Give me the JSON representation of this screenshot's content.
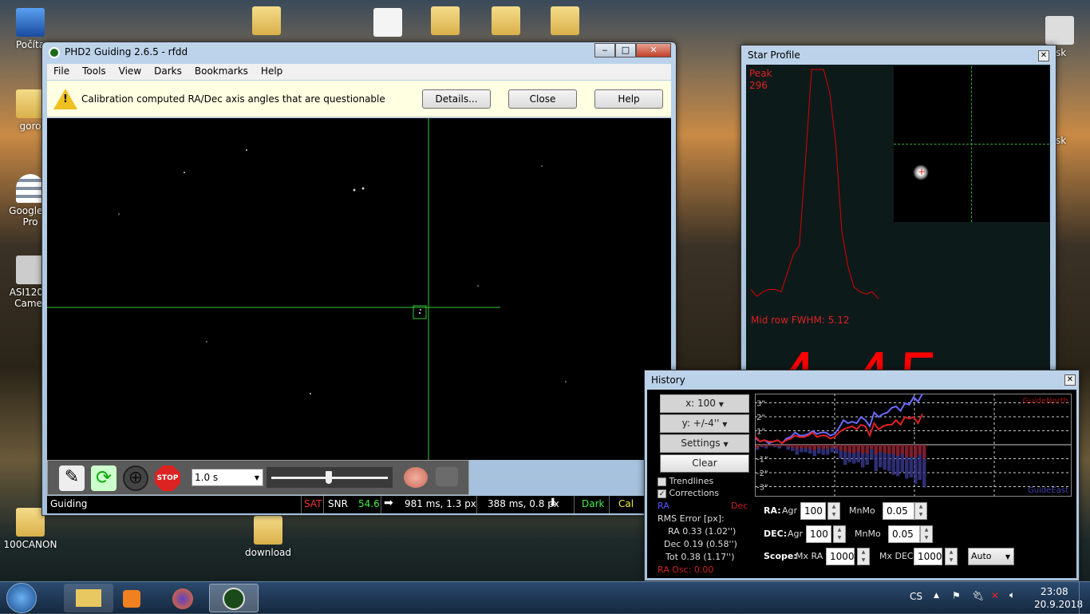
{
  "desktop": {
    "icons": [
      {
        "label": "Počíta"
      },
      {
        "label": "goro"
      },
      {
        "label": "Google E Pro"
      },
      {
        "label": "ASI120M Camer"
      },
      {
        "label": "100CANON"
      },
      {
        "label": "download"
      },
      {
        "label": "isk"
      },
      {
        "label": "isk"
      }
    ]
  },
  "phd2": {
    "title": "PHD2 Guiding 2.6.5 - rfdd",
    "menu": [
      "File",
      "Tools",
      "View",
      "Darks",
      "Bookmarks",
      "Help"
    ],
    "info": {
      "message": "Calibration computed RA/Dec axis angles that are questionable",
      "details": "Details...",
      "close": "Close",
      "help": "Help"
    },
    "toolbar": {
      "exposure": "1.0 s",
      "gamma_fraction": 0.49
    },
    "status": {
      "state": "Guiding",
      "sat": "SAT",
      "snr_label": "SNR",
      "snr": "54.6",
      "ra_pulse": "981 ms, 1.3 px",
      "dec_pulse": "388 ms, 0.8 px",
      "dark": "Dark",
      "cal": "Cal"
    }
  },
  "star_profile": {
    "title": "Star Profile",
    "peak_label": "Peak",
    "peak": "296",
    "fwhm": "Mid row FWHM: 5.12",
    "hfd": "4.45",
    "profile": [
      5,
      2,
      4,
      5,
      5,
      4,
      12,
      20,
      24,
      60,
      100,
      100,
      100,
      90,
      68,
      30,
      15,
      6,
      4,
      3,
      4,
      1
    ]
  },
  "history": {
    "title": "History",
    "x_scale": "x: 100",
    "y_scale": "y: +/-4''",
    "settings": "Settings",
    "clear": "Clear",
    "trendlines": "Trendlines",
    "trendlines_checked": false,
    "corrections": "Corrections",
    "corrections_checked": true,
    "ra_label": "RA",
    "dec_label": "Dec",
    "rms_title": "RMS Error [px]:",
    "rms_ra": "RA 0.33 (1.02'')",
    "rms_dec": "Dec 0.19 (0.58'')",
    "rms_tot": "Tot 0.38 (1.17'')",
    "ra_osc": "RA Osc: 0.00",
    "y_ticks": [
      "3\"",
      "2\"",
      "1\"",
      "-1\"",
      "-2\"",
      "-3\""
    ],
    "north": "GuideNorth",
    "east": "GuideEast",
    "ra_color": "#6a6aff",
    "dec_color": "#e02020",
    "ra_values": [
      0.4,
      0.2,
      0.3,
      0.1,
      0.2,
      0.3,
      0.1,
      0.4,
      0.5,
      0.8,
      0.6,
      0.6,
      0.7,
      0.9,
      0.7,
      0.8,
      0.8,
      0.6,
      0.7,
      1.1,
      1.6,
      1.4,
      1.5,
      1.4,
      1.8,
      1.6,
      1.2,
      2.1,
      1.8,
      2.0,
      2.1,
      2.4,
      2.5,
      2.2,
      2.7,
      2.6,
      3.1,
      2.8,
      3.4
    ],
    "dec_values": [
      0.5,
      0.2,
      0.3,
      0.2,
      0.2,
      0.3,
      0.1,
      0.3,
      0.4,
      0.6,
      0.5,
      0.5,
      0.6,
      0.8,
      0.5,
      0.6,
      0.6,
      0.4,
      0.5,
      0.8,
      1.0,
      1.1,
      1.2,
      1.0,
      1.3,
      1.2,
      0.6,
      1.4,
      1.0,
      1.2,
      1.3,
      1.3,
      1.6,
      1.3,
      1.8,
      1.7,
      1.8,
      1.4,
      2.0
    ],
    "ra_label_b": "RA:",
    "agr": "Agr",
    "ra_agr": "100",
    "mnmo": "MnMo",
    "ra_mnmo": "0.05",
    "dec_label_b": "DEC:",
    "dec_agr": "100",
    "dec_mnmo": "0.05",
    "scope_label": "Scope:",
    "mx_ra_label": "Mx RA",
    "mx_ra": "1000",
    "mx_dec_label": "Mx DEC",
    "mx_dec": "1000",
    "mode": "Auto"
  },
  "taskbar": {
    "lang": "CS",
    "time": "23:08",
    "date": "20.9.2018"
  }
}
